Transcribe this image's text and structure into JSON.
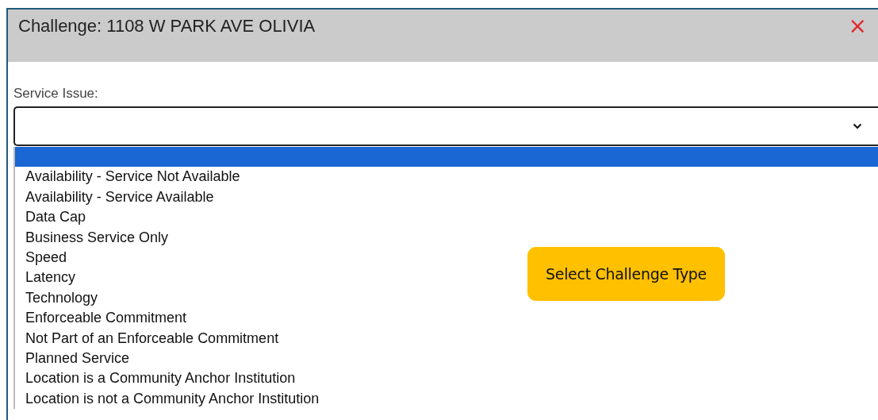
{
  "dialog": {
    "title": "Challenge: 1108 W PARK AVE OLIVIA",
    "close": "×"
  },
  "field": {
    "label": "Service Issue:"
  },
  "options": [
    {
      "selected": true
    },
    {
      "label": "Availability - Service Not Available",
      "selected": false
    },
    {
      "label": "Availability - Service Available",
      "selected": false
    },
    {
      "label": "Data Cap",
      "selected": false
    },
    {
      "label": "Business Service Only",
      "selected": false
    },
    {
      "label": "Speed",
      "selected": false
    },
    {
      "label": "Latency",
      "selected": false
    },
    {
      "label": "Technology",
      "selected": false
    },
    {
      "label": "Enforceable Commitment",
      "selected": false
    },
    {
      "label": "Not Part of an Enforceable Commitment",
      "selected": false
    },
    {
      "label": "Planned Service",
      "selected": false
    },
    {
      "label": "Location is a Community Anchor Institution",
      "selected": false
    },
    {
      "label": "Location is not a Community Anchor Institution",
      "selected": false
    }
  ],
  "callout": {
    "text": "Select Challenge Type"
  }
}
